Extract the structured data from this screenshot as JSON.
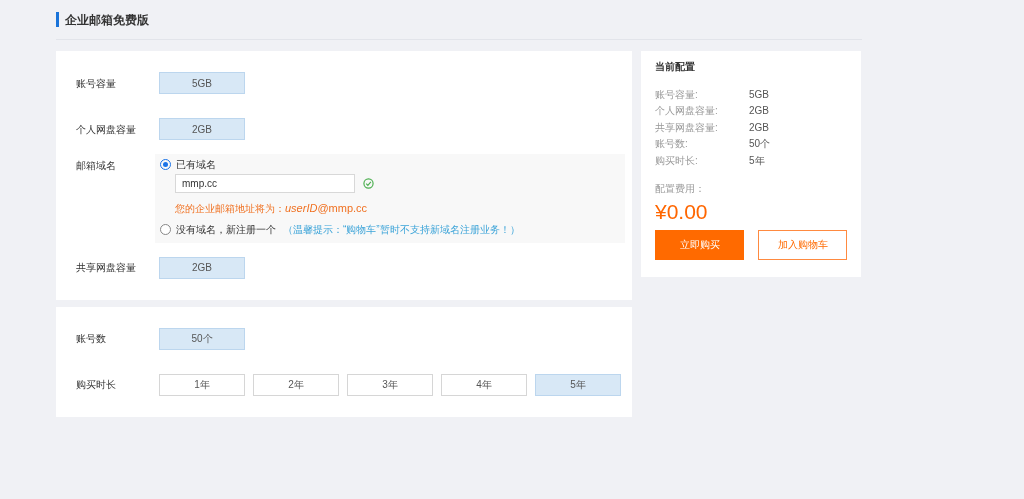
{
  "title": "企业邮箱免费版",
  "cards": [
    {
      "fields": [
        {
          "kind": "options",
          "label": "账号容量",
          "options": [
            {
              "label": "5GB",
              "selected": true
            }
          ]
        },
        {
          "kind": "options",
          "label": "个人网盘容量",
          "options": [
            {
              "label": "2GB",
              "selected": true
            }
          ]
        },
        {
          "kind": "domain",
          "label": "邮箱域名",
          "choices": [
            {
              "label": "已有域名",
              "selected": true
            },
            {
              "label": "没有域名，新注册一个",
              "selected": false,
              "note": "（温馨提示：“购物车”暂时不支持新域名注册业务！）"
            }
          ],
          "input": {
            "value": "mmp.cc",
            "valid": true
          },
          "address_prefix": "您的企业邮箱地址将为：",
          "address": "*userID*@mmp.cc"
        },
        {
          "kind": "options",
          "label": "共享网盘容量",
          "options": [
            {
              "label": "2GB",
              "selected": true
            }
          ]
        }
      ]
    },
    {
      "fields": [
        {
          "kind": "options",
          "label": "账号数",
          "options": [
            {
              "label": "50个",
              "selected": true
            }
          ]
        },
        {
          "kind": "options",
          "label": "购买时长",
          "options": [
            {
              "label": "1年",
              "selected": false
            },
            {
              "label": "2年",
              "selected": false
            },
            {
              "label": "3年",
              "selected": false
            },
            {
              "label": "4年",
              "selected": false
            },
            {
              "label": "5年",
              "selected": true
            }
          ]
        }
      ]
    }
  ],
  "summary": {
    "title": "当前配置",
    "rows": [
      {
        "label": "账号容量:",
        "value": "5GB"
      },
      {
        "label": "个人网盘容量:",
        "value": "2GB"
      },
      {
        "label": "共享网盘容量:",
        "value": "2GB"
      },
      {
        "label": "账号数:",
        "value": "50个"
      },
      {
        "label": "购买时长:",
        "value": "5年"
      }
    ],
    "cost_label": "配置费用：",
    "price": "¥0.00",
    "buttons": [
      "立即购买",
      "加入购物车"
    ]
  }
}
